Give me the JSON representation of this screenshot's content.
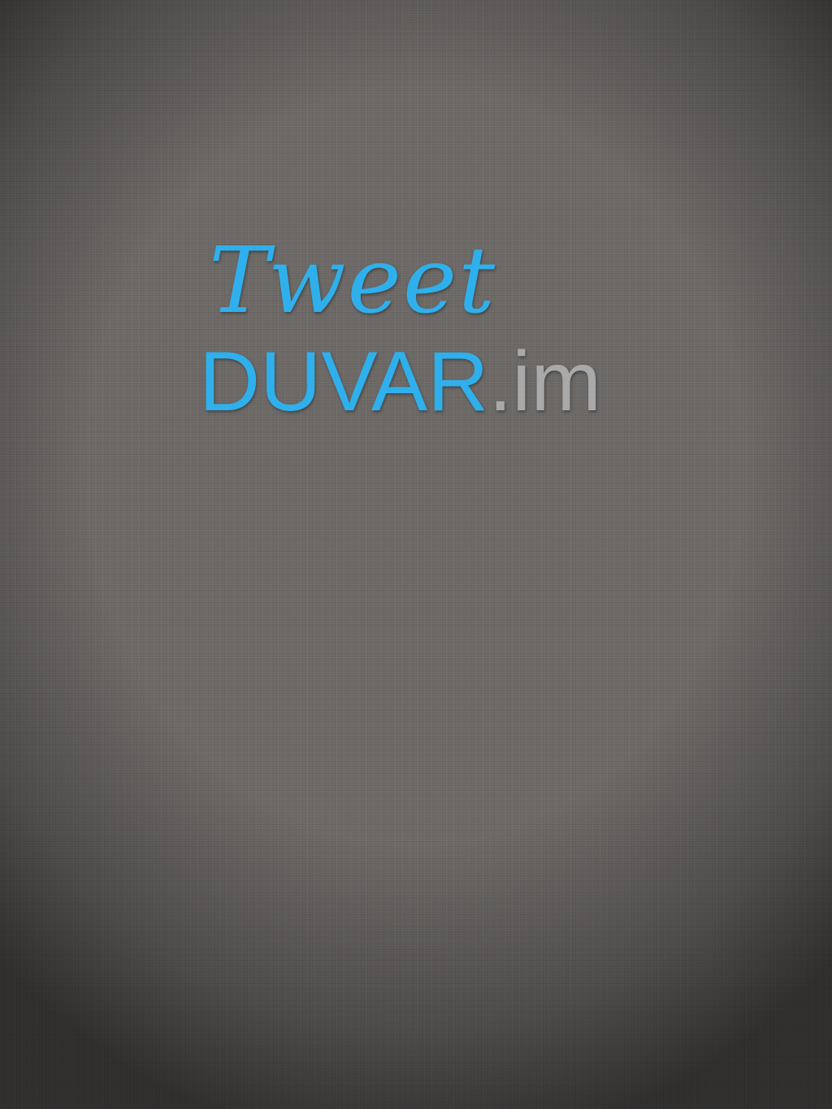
{
  "splash": {
    "logo_script": "Tweet",
    "logo_word": "DUVAR",
    "logo_tld": ".im"
  },
  "colors": {
    "background": "#6b6866",
    "brand_blue": "#2fb0ec",
    "tld_gray": "#a9a9a9"
  }
}
